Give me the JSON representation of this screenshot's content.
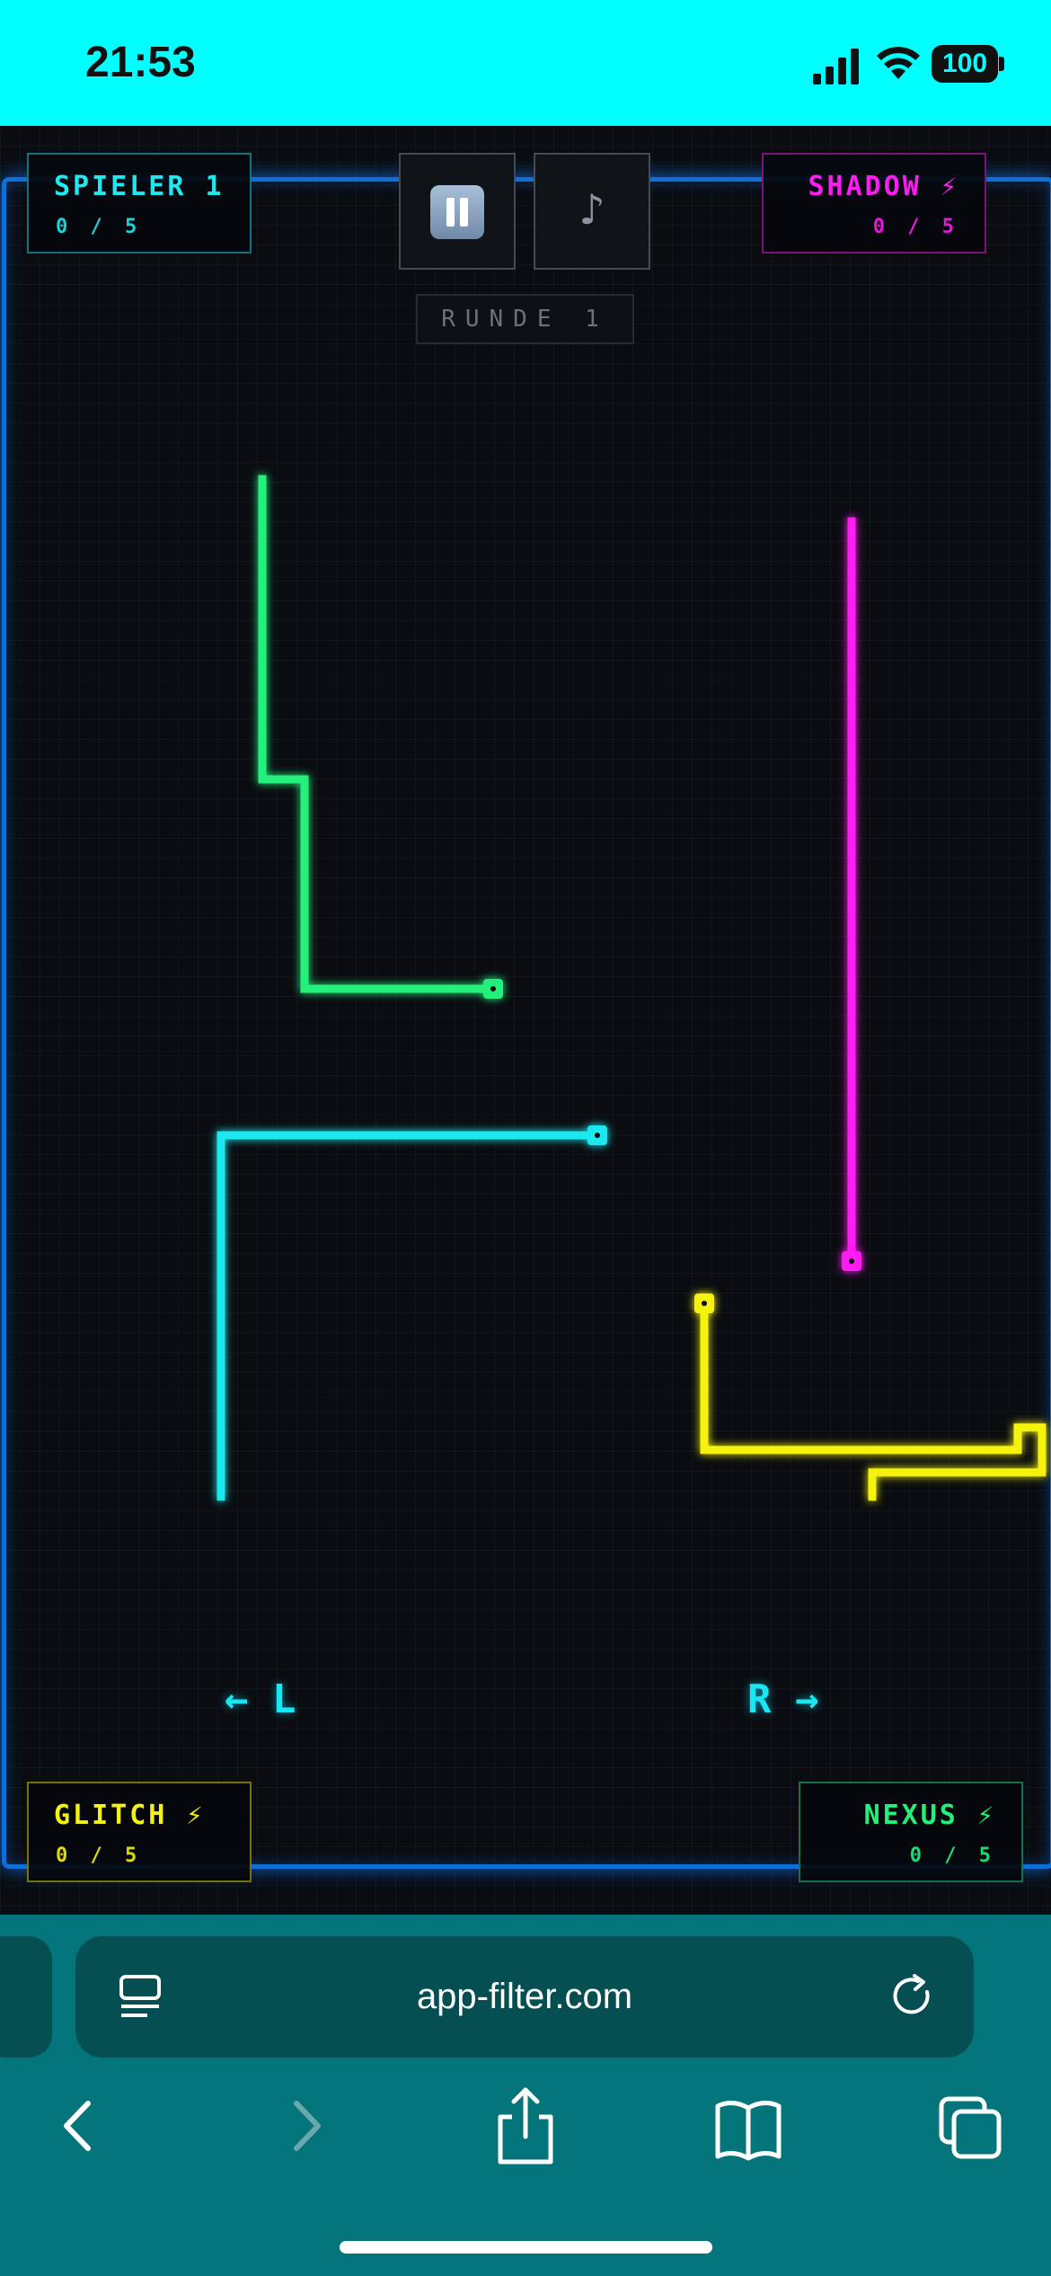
{
  "status_bar": {
    "time": "21:53",
    "battery": "100"
  },
  "game": {
    "players": [
      {
        "name": "SPIELER 1",
        "score": "0 / 5",
        "color": "#1ee8f0"
      },
      {
        "name": "SHADOW ⚡",
        "score": "0 / 5",
        "color": "#ff1cf2"
      },
      {
        "name": "GLITCH ⚡",
        "score": "0 / 5",
        "color": "#f5f20f"
      },
      {
        "name": "NEXUS ⚡",
        "score": "0 / 5",
        "color": "#21f07a"
      }
    ],
    "round_label": "RUNDE 1",
    "pause_icon": "pause-icon",
    "music_icon": "music-note-icon",
    "music_symbol": "♪",
    "controls": {
      "left_hint": "← L",
      "right_hint": "R →"
    },
    "colors": {
      "arena_border": "#0f6fd8",
      "green_trail": "#21f07a",
      "cyan_trail": "#1ee8f0",
      "magenta_trail": "#ff1cf2",
      "yellow_trail": "#f5f20f"
    }
  },
  "browser": {
    "url": "app-filter.com",
    "icons": [
      "tabs-overview-icon",
      "reload-icon",
      "back-icon",
      "forward-icon",
      "share-icon",
      "bookmarks-icon",
      "tabs-icon"
    ]
  }
}
